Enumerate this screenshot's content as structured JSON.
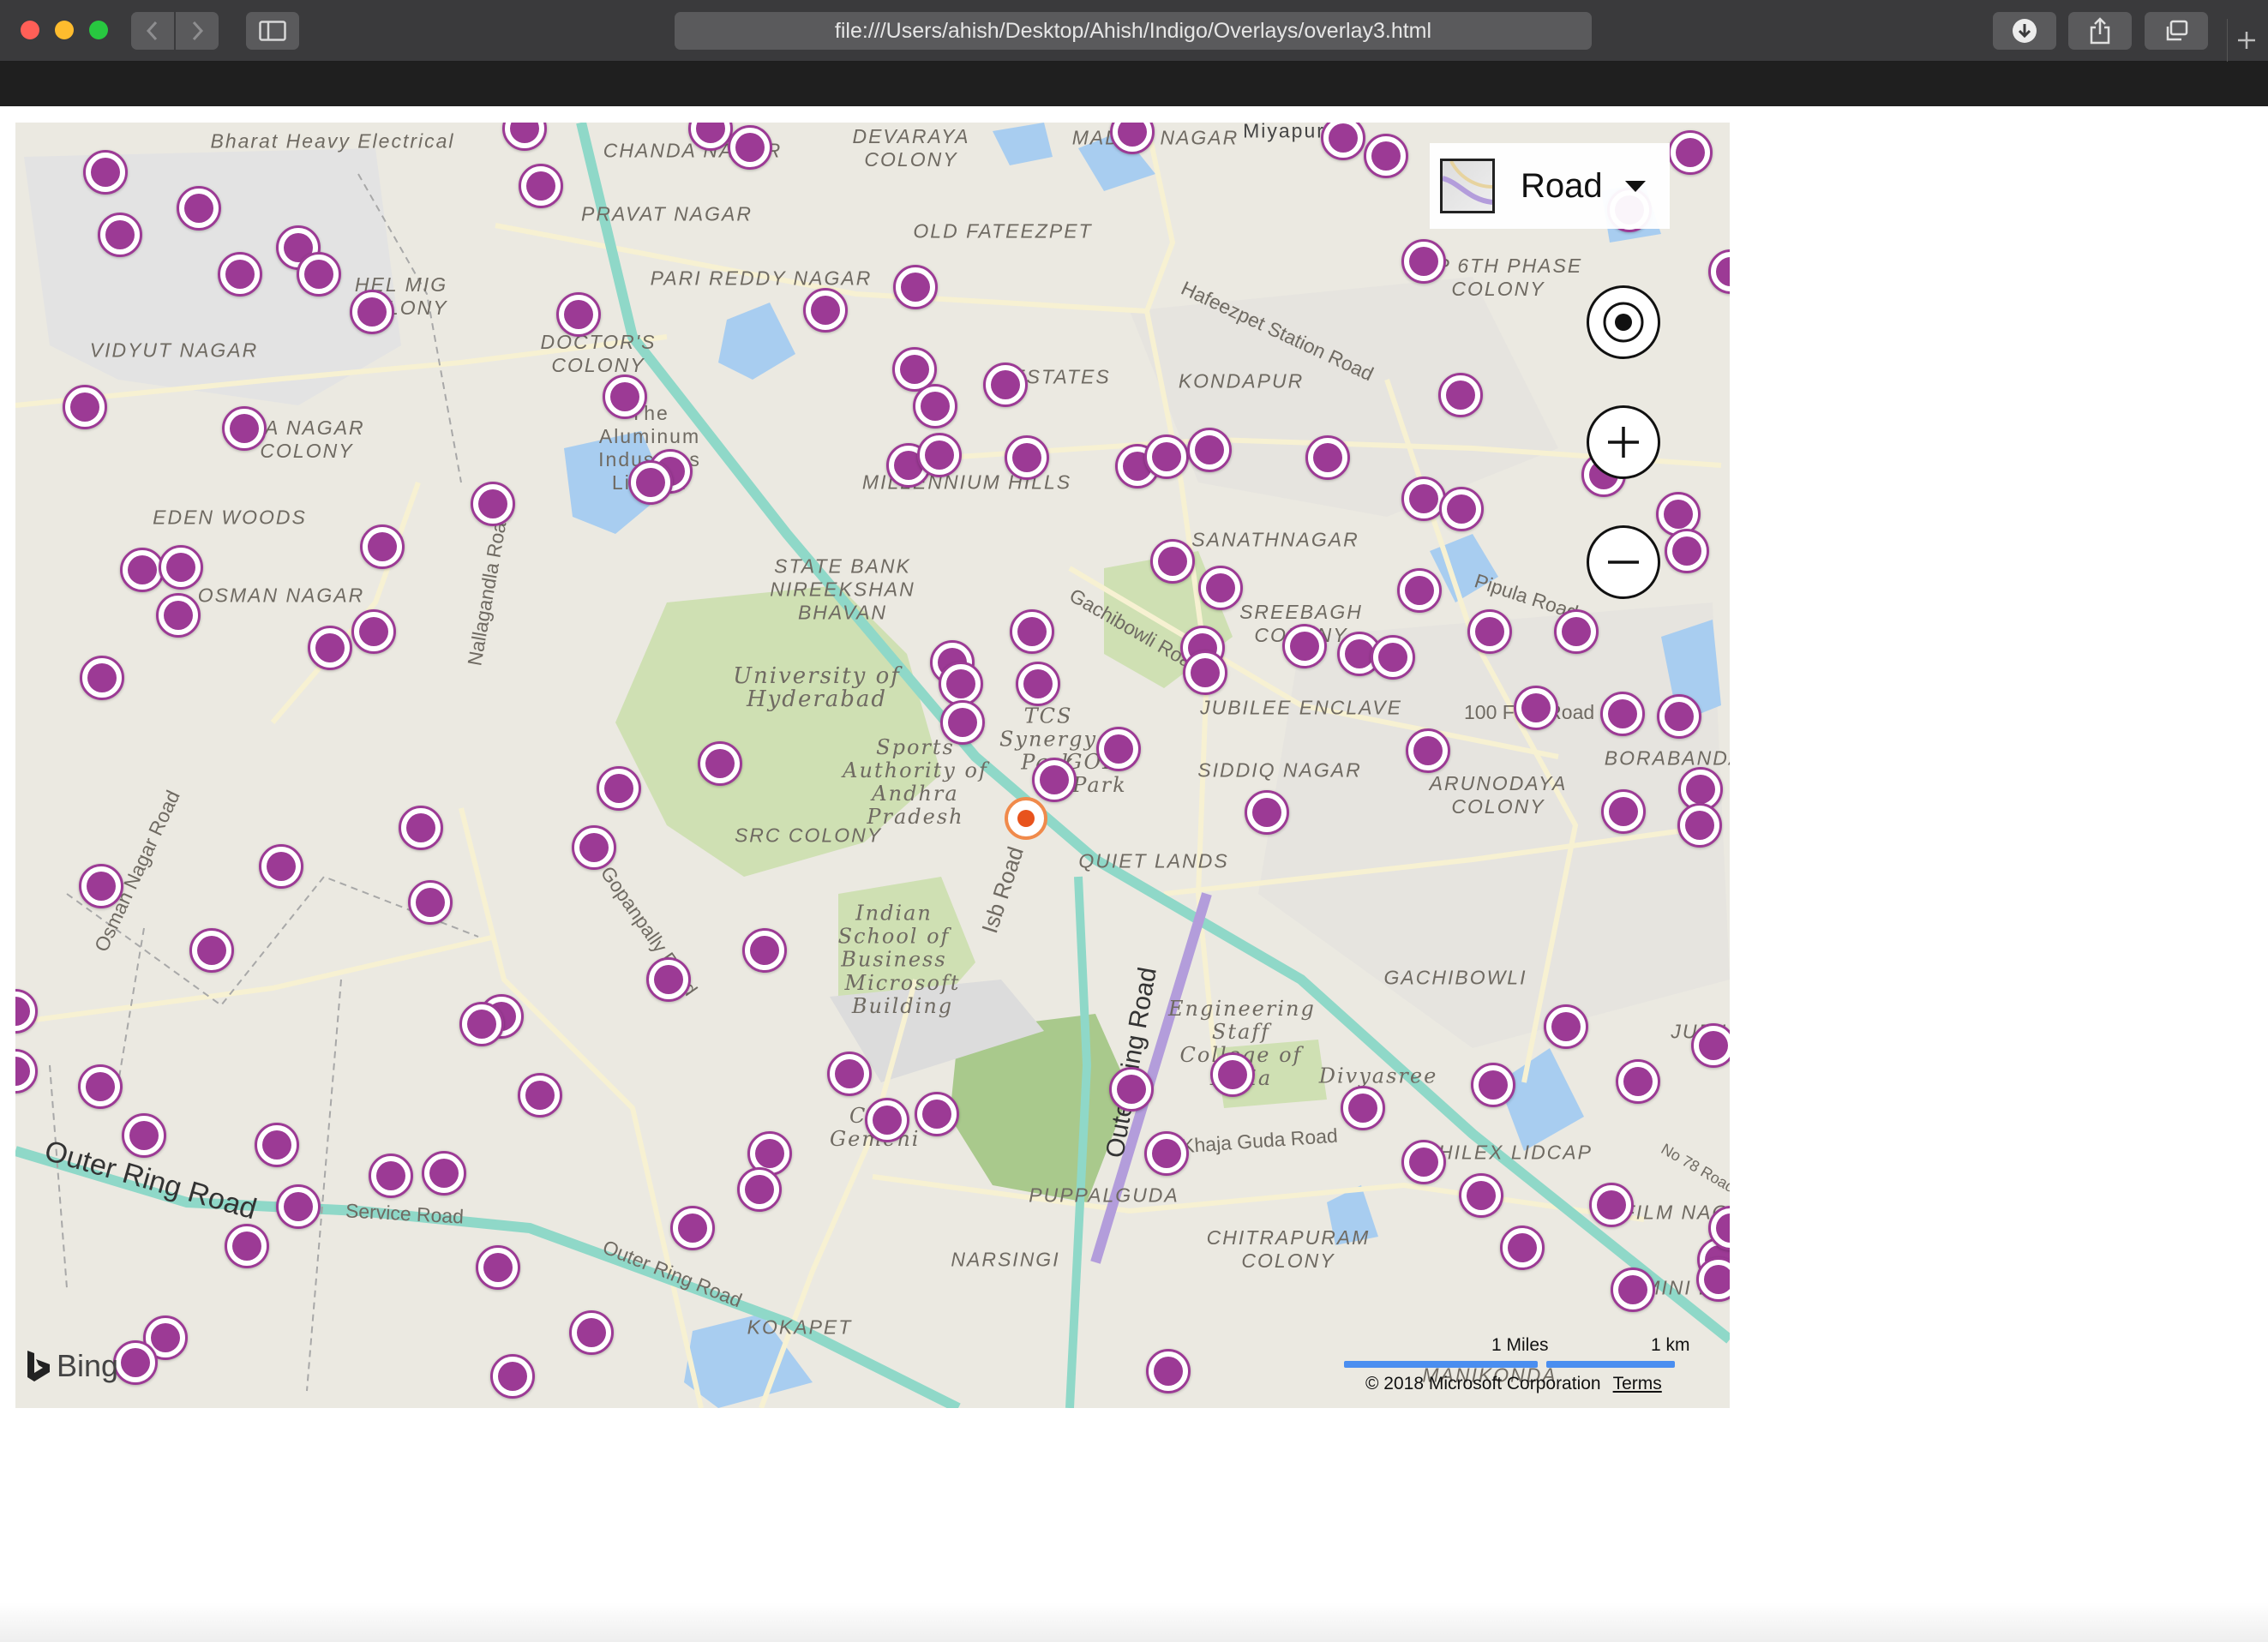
{
  "browser": {
    "url": "file:///Users/ahish/Desktop/Ahish/Indigo/Overlays/overlay3.html",
    "icons": {
      "back": "chevron-left-icon",
      "forward": "chevron-right-icon",
      "sidebar": "sidebar-icon",
      "download": "download-icon",
      "share": "share-icon",
      "tabs": "tabs-icon",
      "new_tab": "plus-icon"
    }
  },
  "map": {
    "style_label": "Road",
    "provider": "Bing",
    "scale_miles": "1 Miles",
    "scale_km": "1 km",
    "copyright": "© 2018 Microsoft Corporation",
    "terms": "Terms",
    "pin_color": "#9c3a95",
    "center_marker_color": "#e8531d",
    "labels": [
      "Bharat Heavy Electrical",
      "CHANDA NAGAR",
      "DEVARAYA COLONY",
      "MADHU NAGAR",
      "Miyapur",
      "PRAVAT NAGAR",
      "OLD FATEEZPET",
      "PARI REDDY NAGAR",
      "HEL MIG COLONY",
      "VIDYUT NAGAR",
      "DOCTOR'S COLONY",
      "K P 6TH PHASE COLONY",
      "Hafeezpet Station Road",
      "ESTATES",
      "KONDAPUR",
      "RA NAGAR COLONY",
      "The Aluminum Industries Limited",
      "MILLENNIUM HILLS",
      "EDEN WOODS",
      "Nallagandla Road",
      "SANATHNAGAR",
      "OSMAN NAGAR",
      "STATE BANK NIREEKSHAN BHAVAN",
      "Pipula Road",
      "Gachibowli Road",
      "SREEBAGH COLONY",
      "University of Hyderabad",
      "JUBILEE ENCLAVE",
      "100 Feet Road",
      "TCS Synergy Park",
      "GOLF Park",
      "BORABANDA",
      "Sports Authority of Andhra Pradesh",
      "SIDDIQ NAGAR",
      "ARUNODAYA COLONY",
      "Osman Nagar Road",
      "SRC COLONY",
      "QUIET LANDS",
      "Isb Road",
      "Gopanpally Road",
      "Indian School of Business",
      "Microsoft Building",
      "Outer Ring Road",
      "GACHIBOWLI",
      "Engineering Staff College of India",
      "Divyasree",
      "JUBILEE",
      "Cap Gemeni",
      "Khaja Guda Road",
      "HILEX LIDCAP",
      "No 78 Road",
      "PUPPALGUDA",
      "FILM NAGAR",
      "Service Road",
      "NARSINGI",
      "CHITRAPURAM COLONY",
      "MINI BAZAR",
      "KOKAPET",
      "MANIKONDA"
    ]
  }
}
